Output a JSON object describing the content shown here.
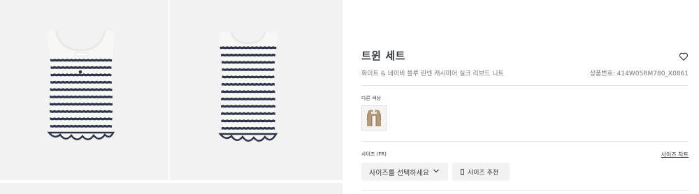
{
  "product": {
    "title": "트윈 세트",
    "subtitle": "화이트 & 네이비 블루 린넨 캐시미어 실크 리브드 니트",
    "reference": "상품번호: 414W05RM780_X0861"
  },
  "gallery": {
    "images": [
      {
        "name": "front-view",
        "icon": "tank-top-front"
      },
      {
        "name": "back-view",
        "icon": "tank-top-back"
      }
    ]
  },
  "colors": {
    "label": "다른 색상",
    "swatches": [
      {
        "name": "beige-cardigan",
        "icon": "cardigan-thumbnail"
      }
    ]
  },
  "size": {
    "label": "사이즈 (FR)",
    "chart_link": "사이즈 차트",
    "select_placeholder": "사이즈를 선택하세요",
    "recommend_button": "사이즈 추천"
  },
  "icons": {
    "wishlist": "heart-icon",
    "select": "chevron-down-icon",
    "recommend": "ruler-icon"
  },
  "theme": {
    "stripe_color": "#2e3548",
    "knit_color": "#f7f7f5",
    "background": "#f2f2f2",
    "swatch_color": "#b49a78"
  }
}
